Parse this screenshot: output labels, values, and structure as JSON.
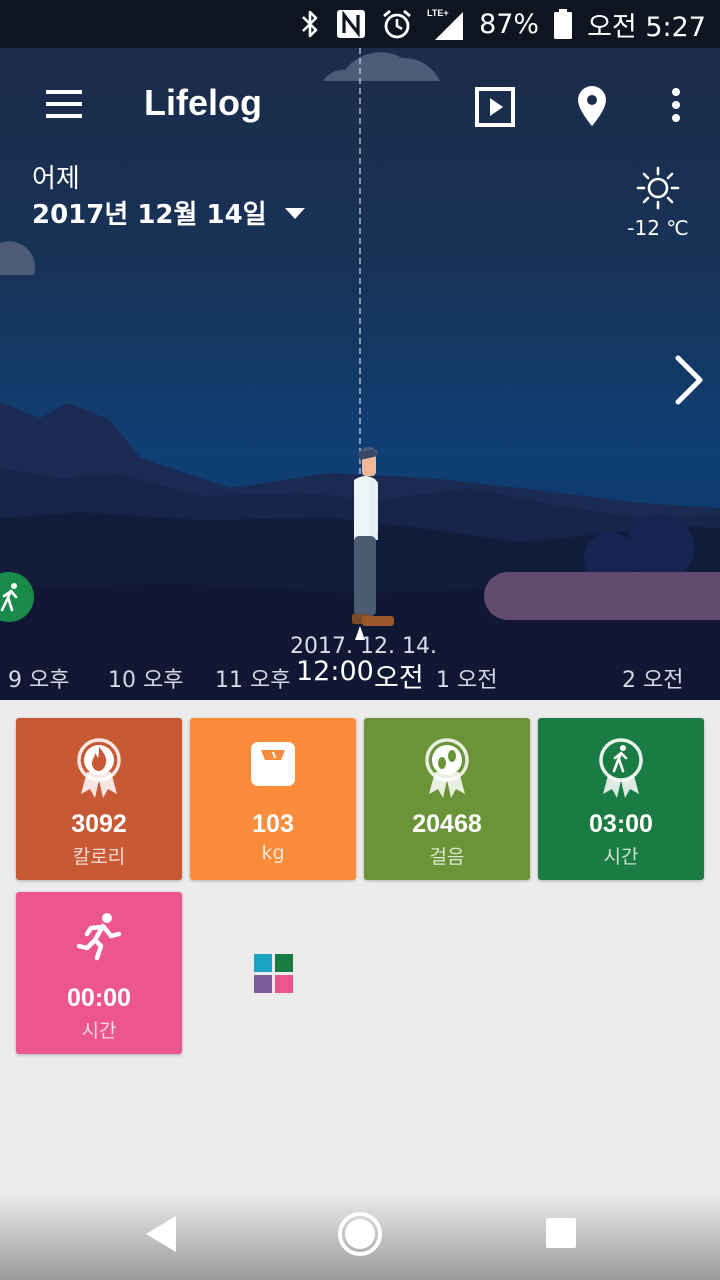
{
  "status_bar": {
    "battery": "87%",
    "time": "오전 5:27",
    "network": "LTE+",
    "icons": [
      "bluetooth-icon",
      "nfc-icon",
      "alarm-icon",
      "signal-icon",
      "battery-icon"
    ]
  },
  "app": {
    "title": "Lifelog"
  },
  "date": {
    "relative": "어제",
    "full": "2017년 12월 14일"
  },
  "weather": {
    "icon": "sun-icon",
    "temperature": "-12 ℃"
  },
  "timeline": {
    "date": "2017. 12. 14.",
    "labels": [
      "9 오후",
      "10 오후",
      "11 오후",
      "12:00",
      "오전",
      "1 오전",
      "2 오전"
    ]
  },
  "tiles": [
    {
      "value": "3092",
      "unit": "칼로리",
      "icon": "calorie-flame-icon",
      "color": "#c75935"
    },
    {
      "value": "103",
      "unit": "kg",
      "icon": "weight-scale-icon",
      "color": "#fa8c3c"
    },
    {
      "value": "20468",
      "unit": "걸음",
      "icon": "footsteps-icon",
      "color": "#6a9437"
    },
    {
      "value": "03:00",
      "unit": "시간",
      "icon": "walking-icon",
      "color": "#1b7c43"
    },
    {
      "value": "00:00",
      "unit": "시간",
      "icon": "running-icon",
      "color": "#ec558e"
    }
  ],
  "colors": {
    "accent_green": "#1a8a4a",
    "activity_bar": "#62496e"
  }
}
